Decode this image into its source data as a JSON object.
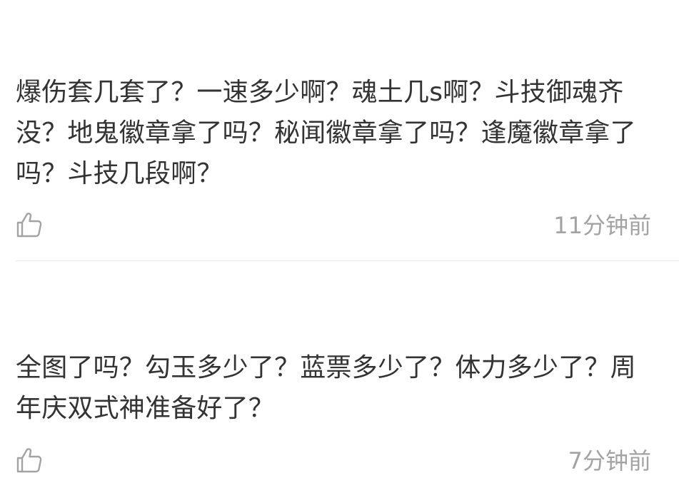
{
  "comments": [
    {
      "text": "爆伤套几套了？一速多少啊？魂土几s啊？斗技御魂齐没？地鬼徽章拿了吗？秘闻徽章拿了吗？逢魔徽章拿了吗？斗技几段啊？",
      "like_icon": "thumbs-up-outline",
      "timestamp": "11分钟前"
    },
    {
      "text": "全图了吗？勾玉多少了？蓝票多少了？体力多少了？周年庆双式神准备好了？",
      "like_icon": "thumbs-up-outline",
      "timestamp": "7分钟前"
    }
  ],
  "colors": {
    "text": "#333333",
    "muted": "#a3a3a3",
    "divider": "#ebebeb"
  }
}
